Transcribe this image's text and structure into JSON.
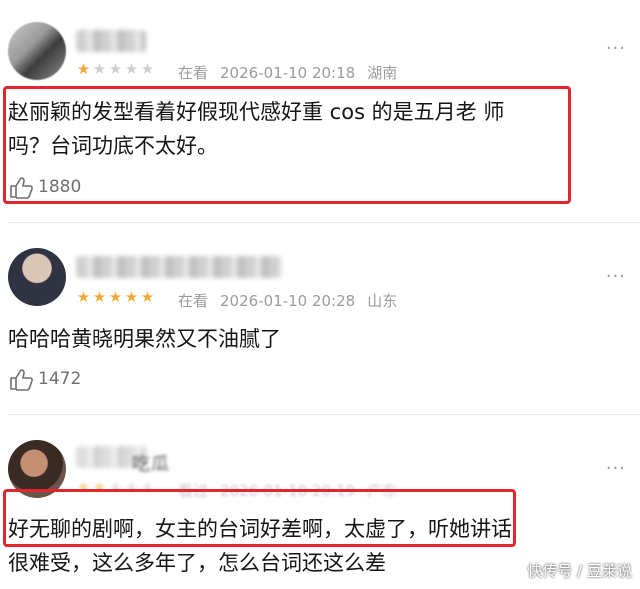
{
  "comments": [
    {
      "stars_on": 1,
      "status": "在看",
      "datetime": "2026-01-10 20:18",
      "location": "湖南",
      "text_line1": "赵丽颖的发型看着好假现代感好重 cos 的是五月老 师",
      "text_line2": "吗？台词功底不太好。",
      "likes": "1880",
      "more": "···"
    },
    {
      "stars_on": 5,
      "status": "在看",
      "datetime": "2026-01-10 20:28",
      "location": "山东",
      "text_line1": "哈哈哈黄晓明果然又不油腻了",
      "likes": "1472",
      "more": "···"
    },
    {
      "username": "吃瓜",
      "stars_on": 2,
      "status": "看过",
      "datetime": "2026-01-10 20:19",
      "location": "广东",
      "text_line1": "好无聊的剧啊，女主的台词好差啊，太虚了，听她讲话",
      "text_line2": "很难受，这么多年了，怎么台词还这么差",
      "more": "···"
    }
  ],
  "star_glyph": "★",
  "watermark": "快传号 / 豆莱说",
  "colors": {
    "highlight": "#e2262c",
    "star_on": "#f2a93b",
    "star_off": "#d0d0d0"
  }
}
